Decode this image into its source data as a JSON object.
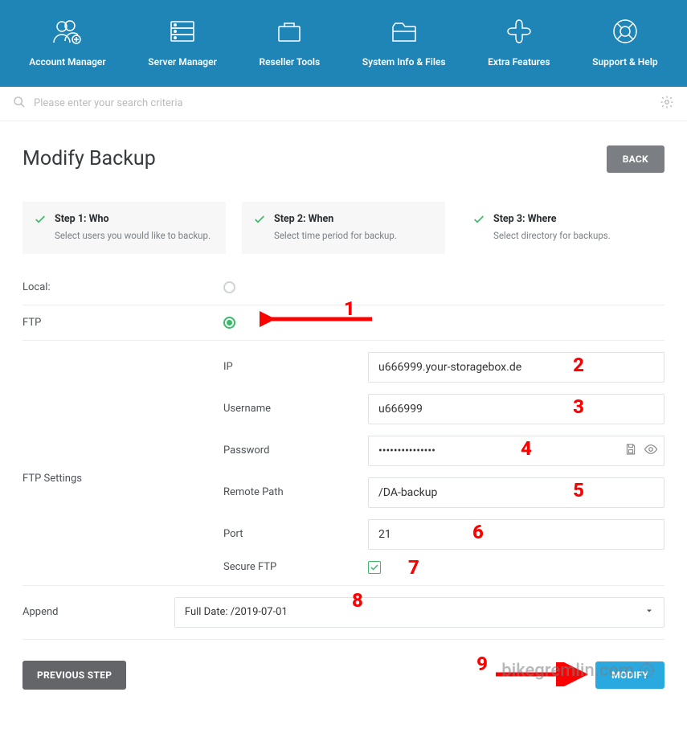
{
  "nav": {
    "items": [
      {
        "label": "Account Manager"
      },
      {
        "label": "Server Manager"
      },
      {
        "label": "Reseller Tools"
      },
      {
        "label": "System Info & Files"
      },
      {
        "label": "Extra Features"
      },
      {
        "label": "Support & Help"
      }
    ]
  },
  "search": {
    "placeholder": "Please enter your search criteria"
  },
  "page": {
    "title": "Modify Backup",
    "back_label": "BACK",
    "prev_label": "PREVIOUS STEP",
    "modify_label": "MODIFY"
  },
  "steps": [
    {
      "title": "Step 1: Who",
      "desc": "Select users you would like to backup."
    },
    {
      "title": "Step 2: When",
      "desc": "Select time period for backup."
    },
    {
      "title": "Step 3: Where",
      "desc": "Select directory for backups."
    }
  ],
  "location": {
    "local_label": "Local:",
    "ftp_label": "FTP",
    "selected": "ftp"
  },
  "ftp": {
    "section_label": "FTP Settings",
    "fields": {
      "ip": {
        "label": "IP",
        "value": "u666999.your-storagebox.de"
      },
      "username": {
        "label": "Username",
        "value": "u666999"
      },
      "password": {
        "label": "Password",
        "value": "•••••••••••••••"
      },
      "remote_path": {
        "label": "Remote Path",
        "value": "/DA-backup"
      },
      "port": {
        "label": "Port",
        "value": "21"
      },
      "secure": {
        "label": "Secure FTP",
        "checked": true
      }
    }
  },
  "append": {
    "label": "Append",
    "selected": "Full Date: /2019-07-01"
  },
  "annotations": {
    "n1": "1",
    "n2": "2",
    "n3": "3",
    "n4": "4",
    "n5": "5",
    "n6": "6",
    "n7": "7",
    "n8": "8",
    "n9": "9"
  },
  "watermark": "bikegremlin.com"
}
